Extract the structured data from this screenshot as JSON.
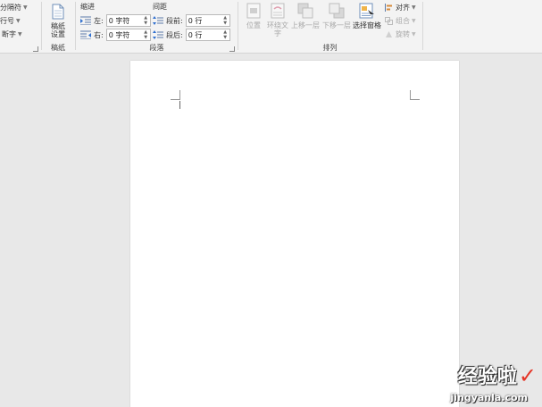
{
  "ribbon": {
    "page_setup_partial": {
      "items": [
        "分隔符",
        "行号",
        "断字"
      ]
    },
    "draft": {
      "button_label": "稿纸\n设置",
      "group_label": "稿纸"
    },
    "paragraph": {
      "indent_header": "缩进",
      "spacing_header": "间距",
      "left_label": "左:",
      "left_value": "0 字符",
      "right_label": "右:",
      "right_value": "0 字符",
      "before_label": "段前:",
      "before_value": "0 行",
      "after_label": "段后:",
      "after_value": "0 行",
      "group_label": "段落"
    },
    "arrange": {
      "position_label": "位置",
      "wrap_label": "环绕文\n字",
      "bring_forward_label": "上移一层",
      "send_backward_label": "下移一层",
      "selection_pane_label": "选择窗格",
      "align_label": "对齐",
      "group_label": "组合",
      "rotate_label": "旋转",
      "group_title": "排列"
    }
  },
  "watermark": {
    "main": "经验啦",
    "url": "jingyanla.com"
  },
  "colors": {
    "ribbon_bg": "#f3f3f3",
    "workspace_bg": "#e8e8e8",
    "page_bg": "#ffffff",
    "watermark_check": "#e53527"
  }
}
